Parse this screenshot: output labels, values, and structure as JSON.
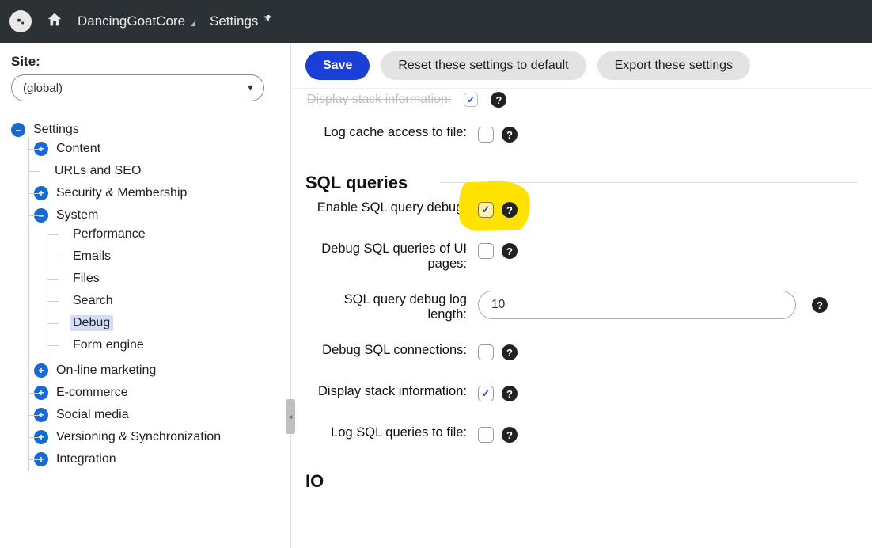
{
  "header": {
    "app_crumb": "DancingGoatCore",
    "page_crumb": "Settings"
  },
  "sidebar": {
    "site_label": "Site:",
    "site_value": "(global)",
    "tree": {
      "root": "Settings",
      "items": [
        {
          "label": "Content",
          "expandable": true
        },
        {
          "label": "URLs and SEO",
          "expandable": false
        },
        {
          "label": "Security & Membership",
          "expandable": true
        },
        {
          "label": "System",
          "expandable": true,
          "expanded": true,
          "children": [
            {
              "label": "Performance"
            },
            {
              "label": "Emails"
            },
            {
              "label": "Files"
            },
            {
              "label": "Search"
            },
            {
              "label": "Debug",
              "selected": true
            },
            {
              "label": "Form engine"
            }
          ]
        },
        {
          "label": "On-line marketing",
          "expandable": true
        },
        {
          "label": "E-commerce",
          "expandable": true
        },
        {
          "label": "Social media",
          "expandable": true
        },
        {
          "label": "Versioning & Synchronization",
          "expandable": true
        },
        {
          "label": "Integration",
          "expandable": true
        }
      ]
    }
  },
  "toolbar": {
    "save": "Save",
    "reset": "Reset these settings to default",
    "export": "Export these settings"
  },
  "clipped": {
    "label": "Display stack information:",
    "help": "?"
  },
  "cache": {
    "log_to_file_label": "Log cache access to file:"
  },
  "sql": {
    "heading": "SQL queries",
    "enable_label": "Enable SQL query debug:",
    "enable_checked": true,
    "ui_pages_label": "Debug SQL queries of UI pages:",
    "ui_pages_checked": false,
    "log_length_label": "SQL query debug log length:",
    "log_length_value": "10",
    "connections_label": "Debug SQL connections:",
    "connections_checked": false,
    "stack_label": "Display stack information:",
    "stack_checked": true,
    "log_file_label": "Log SQL queries to file:",
    "log_file_checked": false
  },
  "io": {
    "heading": "IO"
  },
  "icons": {
    "help": "?"
  },
  "colors": {
    "accent": "#1a3fd6",
    "highlight": "#ffe200",
    "topbar": "#2c3136"
  }
}
